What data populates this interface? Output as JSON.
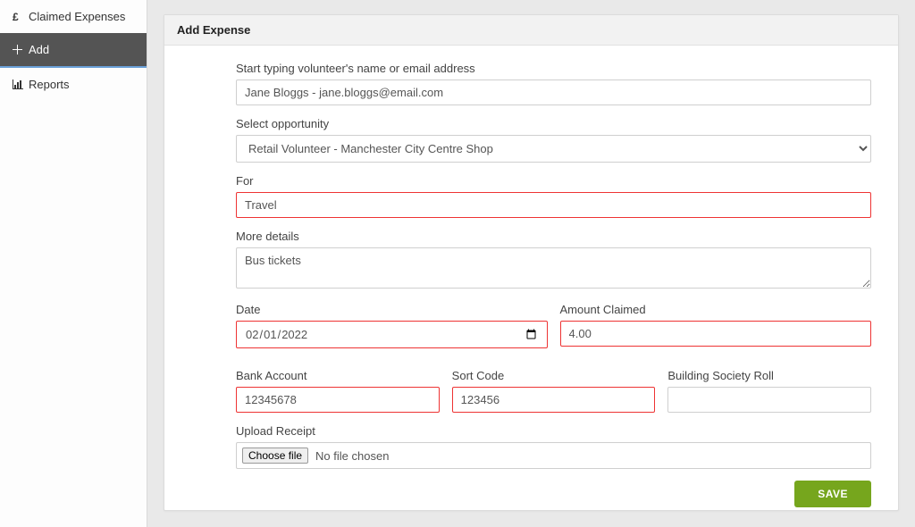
{
  "sidebar": {
    "items": [
      {
        "label": "Claimed Expenses",
        "icon": "pound-icon"
      },
      {
        "label": "Add",
        "icon": "plus-icon"
      },
      {
        "label": "Reports",
        "icon": "chart-icon"
      }
    ]
  },
  "panel": {
    "title": "Add Expense"
  },
  "form": {
    "volunteer": {
      "label": "Start typing volunteer's name or email address",
      "value": "Jane Bloggs - jane.bloggs@email.com"
    },
    "opportunity": {
      "label": "Select opportunity",
      "value": "Retail Volunteer - Manchester City Centre Shop"
    },
    "for": {
      "label": "For",
      "value": "Travel"
    },
    "more_details": {
      "label": "More details",
      "value": "Bus tickets"
    },
    "date": {
      "label": "Date",
      "value": "2022-02-01"
    },
    "amount": {
      "label": "Amount Claimed",
      "value": "4.00"
    },
    "bank_account": {
      "label": "Bank Account",
      "value": "12345678"
    },
    "sort_code": {
      "label": "Sort Code",
      "value": "123456"
    },
    "building_society": {
      "label": "Building Society Roll",
      "value": ""
    },
    "upload": {
      "label": "Upload Receipt",
      "button": "Choose file",
      "status": "No file chosen"
    },
    "save_label": "SAVE"
  }
}
